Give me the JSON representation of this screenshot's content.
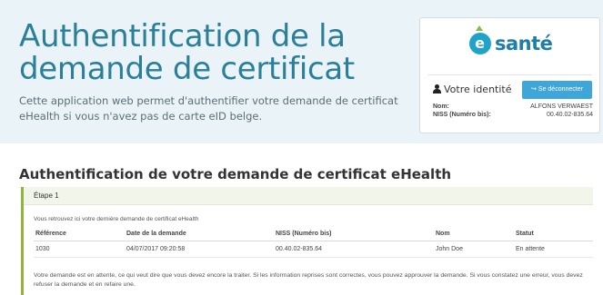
{
  "hero": {
    "title": "Authentification de la demande de certificat",
    "description": "Cette application web permet d'authentifier votre demande de certificat eHealth si vous n'avez pas de carte eID belge."
  },
  "identity": {
    "logo_letter": "e",
    "logo_text": "santé",
    "heading": "Votre identité",
    "logout_label": "Se déconnecter",
    "name_label": "Nom:",
    "name_value": "ALFONS VERWAEST",
    "niss_label": "NISS (Numéro bis):",
    "niss_value": "00.40.02-835.64"
  },
  "main": {
    "section_title": "Authentification de votre demande de certificat eHealth",
    "step_label": "Étape 1",
    "intro": "Vous retrouvez ici votre dernière demande de certificat eHealth",
    "table": {
      "headers": [
        "Référence",
        "Date de la demande",
        "NISS (Numéro bis)",
        "Nom",
        "Statut"
      ],
      "rows": [
        [
          "1030",
          "04/07/2017 09:20:58",
          "00.40.02-835.64",
          "John Doe",
          "En attente"
        ]
      ]
    },
    "note": "Votre demande est en attente, ce qui veut dire que vous devez encore la traiter. Si les information reprises sont correctes, vous pouvez approuver la demande. Si vous constatez une erreur, vous devez refuser la demande et en refaire une."
  },
  "colors": {
    "title": "#2b7f99",
    "hero_bg": "#eaf3f7",
    "button": "#3fa6d9",
    "panel_accent": "#8fb53b"
  }
}
